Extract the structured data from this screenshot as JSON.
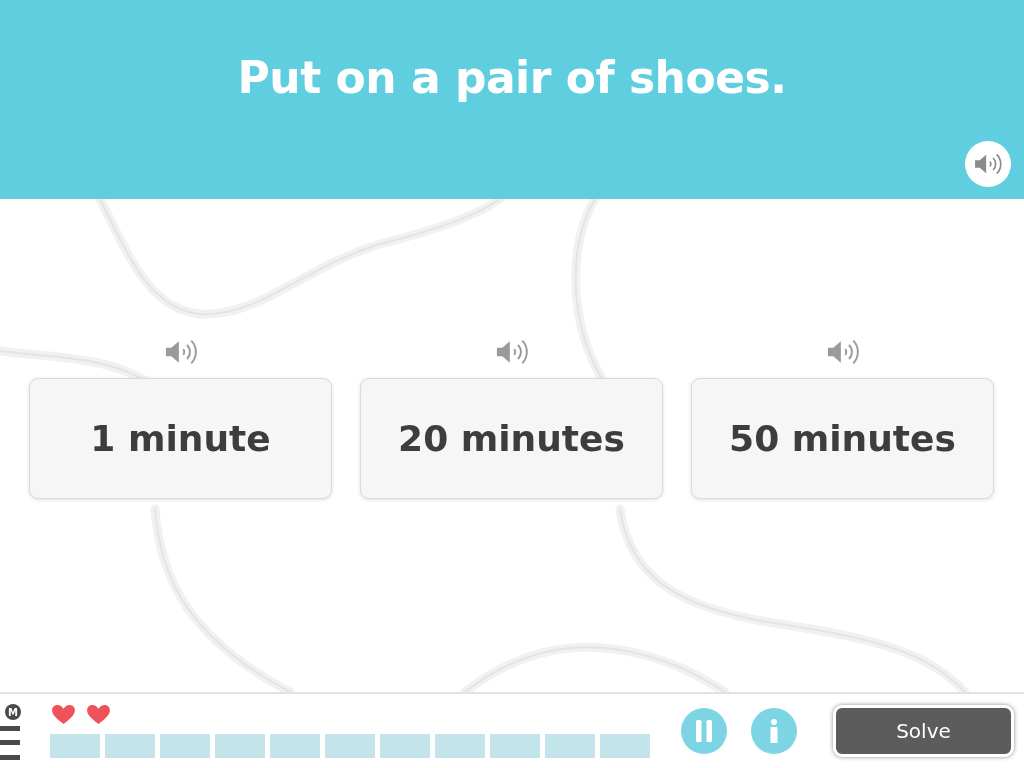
{
  "question": {
    "text": "Put on a pair of shoes."
  },
  "answers": [
    {
      "label": "1 minute",
      "selected": false
    },
    {
      "label": "20 minutes",
      "selected": false
    },
    {
      "label": "50 minutes",
      "selected": false
    }
  ],
  "status_bar": {
    "menu_badge": "M",
    "lives": [
      {
        "full": true
      },
      {
        "full": true
      }
    ],
    "progress": [
      {
        "done": false
      },
      {
        "done": false
      },
      {
        "done": false
      },
      {
        "done": false
      },
      {
        "done": false
      },
      {
        "done": false
      },
      {
        "done": false
      },
      {
        "done": false
      },
      {
        "done": false
      },
      {
        "done": false
      },
      {
        "done": false
      }
    ],
    "buttons": [
      {
        "kind": "pause"
      },
      {
        "kind": "info"
      },
      {
        "kind": "solve",
        "label": "Solve"
      }
    ]
  }
}
